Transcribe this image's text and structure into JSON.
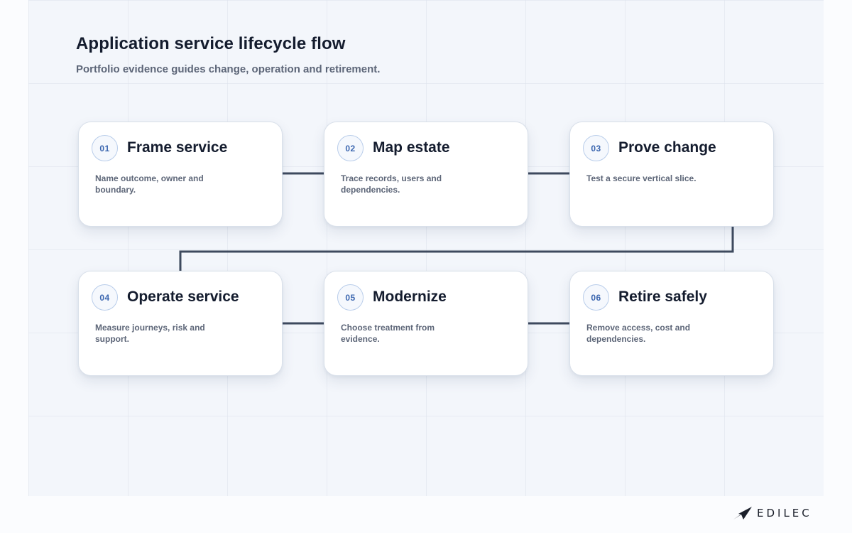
{
  "title": "Application service lifecycle flow",
  "subtitle": "Portfolio evidence guides change, operation and retirement.",
  "steps": [
    {
      "number": "01",
      "title": "Frame service",
      "description": "Name outcome, owner and boundary."
    },
    {
      "number": "02",
      "title": "Map estate",
      "description": "Trace records, users and dependencies."
    },
    {
      "number": "03",
      "title": "Prove change",
      "description": "Test a secure vertical slice."
    },
    {
      "number": "04",
      "title": "Operate service",
      "description": "Measure journeys, risk and support."
    },
    {
      "number": "05",
      "title": "Modernize",
      "description": "Choose treatment from evidence."
    },
    {
      "number": "06",
      "title": "Retire safely",
      "description": "Remove access, cost and dependencies."
    }
  ],
  "flow": [
    {
      "from": "01",
      "to": "02"
    },
    {
      "from": "02",
      "to": "03"
    },
    {
      "from": "03",
      "to": "04"
    },
    {
      "from": "04",
      "to": "05"
    },
    {
      "from": "05",
      "to": "06"
    }
  ],
  "brand": {
    "logo_text": "EDILEC",
    "logo_icon": "paper-plane-logo-icon"
  },
  "colors": {
    "connector": "#3e4a5e",
    "badge_text": "#3c67b0",
    "badge_border": "#b9cdea",
    "title": "#141c2e",
    "muted": "#5d6678"
  }
}
